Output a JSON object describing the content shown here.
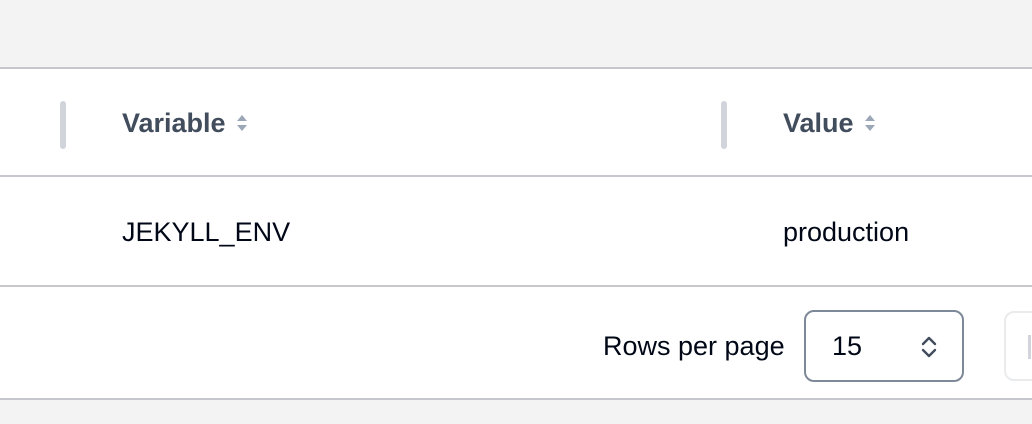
{
  "table": {
    "columns": [
      {
        "label": "Variable",
        "sortable": true
      },
      {
        "label": "Value",
        "sortable": true
      }
    ],
    "rows": [
      {
        "variable": "JEKYLL_ENV",
        "value": "production"
      }
    ]
  },
  "pagination": {
    "rows_per_page_label": "Rows per page",
    "rows_per_page_value": "15"
  },
  "colors": {
    "header_text": "#414d5c",
    "body_text": "#000716",
    "border": "#c6c6cd",
    "background": "#f3f3f3"
  }
}
